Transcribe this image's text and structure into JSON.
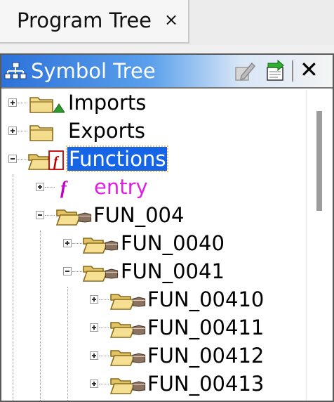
{
  "program_tree_tab": {
    "label": "Program Tree",
    "close_glyph": "×"
  },
  "symbol_tree": {
    "title": "Symbol Tree",
    "title_icon": "tree-icon",
    "toolbar": {
      "edit_icon": "edit-label-icon",
      "go_to_icon": "go-to-icon",
      "close_glyph": "✕"
    },
    "items": [
      {
        "label": "Imports",
        "icon": "imports-folder-icon",
        "expanded": false
      },
      {
        "label": "Exports",
        "icon": "exports-folder-icon",
        "expanded": false
      },
      {
        "label": "Functions",
        "icon": "functions-folder-icon",
        "expanded": true,
        "selected": true
      },
      {
        "label": "entry",
        "icon": "function-icon",
        "expanded": false
      },
      {
        "label": "FUN_004",
        "icon": "folder-icon",
        "expanded": true
      },
      {
        "label": "FUN_0040",
        "icon": "folder-icon",
        "expanded": false
      },
      {
        "label": "FUN_0041",
        "icon": "folder-icon",
        "expanded": true
      },
      {
        "label": "FUN_00410",
        "icon": "folder-icon",
        "expanded": false
      },
      {
        "label": "FUN_00411",
        "icon": "folder-icon",
        "expanded": false
      },
      {
        "label": "FUN_00412",
        "icon": "folder-icon",
        "expanded": false
      },
      {
        "label": "FUN_00413",
        "icon": "folder-icon",
        "expanded": false
      }
    ]
  }
}
